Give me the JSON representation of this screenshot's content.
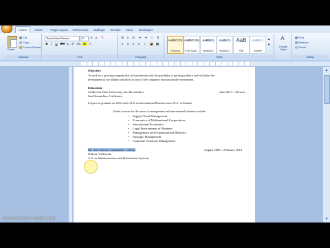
{
  "ribbon": {
    "tabs": [
      "Home",
      "Insert",
      "Page Layout",
      "References",
      "Mailings",
      "Review",
      "View",
      "Developer"
    ],
    "clipboard": {
      "paste": "Paste",
      "cut": "Cut",
      "copy": "Copy",
      "format_painter": "Format Painter",
      "group": "Clipboard"
    },
    "font": {
      "name": "Times New Roman",
      "size": "10",
      "group": "Font"
    },
    "paragraph": {
      "group": "Paragraph"
    },
    "styles": {
      "items": [
        {
          "sample": "AaBbCcDc",
          "name": "¶ Normal"
        },
        {
          "sample": "AaBbCcDc",
          "name": "¶ No Spaci..."
        },
        {
          "sample": "AaBbCc",
          "name": "Heading 1"
        },
        {
          "sample": "AaBbCc",
          "name": "Heading 2"
        },
        {
          "sample": "AaB",
          "name": "Title"
        },
        {
          "sample": "AaBbCc.",
          "name": "Subtitle"
        }
      ],
      "change_styles": "Change Styles",
      "group": "Styles"
    },
    "editing": {
      "find": "Find",
      "replace": "Replace",
      "select": "Select",
      "group": "Editing"
    }
  },
  "document": {
    "objective_heading": "Objective",
    "objective_line1": "To work for a growing company that will provide me with the possibility of growing within it and will allow the",
    "objective_line2": "development of my abilities and skills in favor of the company's mission and the environment.",
    "education_heading": "Education",
    "school1": "California State University, San Bernardino",
    "school1_dates": "June 2013 – Present",
    "school1_city": "San Bernardino, California",
    "graduation": "I expect to graduate on 2012 with a B.S. in International Business and a B.A. in Finance",
    "courses_intro": "Useful courses for the areas of management and international business include:",
    "courses": [
      "Supply Chain Management",
      "Economics of Multinational Corporations",
      "International Economics",
      "Legal Environment of Business",
      "Management and Organizational Behavior",
      "Strategic Management",
      "Corporate Financial Management"
    ],
    "school2": "Mt. San Antonio Community College",
    "school2_dates": "August 2006 – February 2010",
    "school2_city": "Walnut, California",
    "school2_degree": "A.S. in Administration and Information Systems"
  },
  "watermark": "Screencast-O-Matic.com"
}
